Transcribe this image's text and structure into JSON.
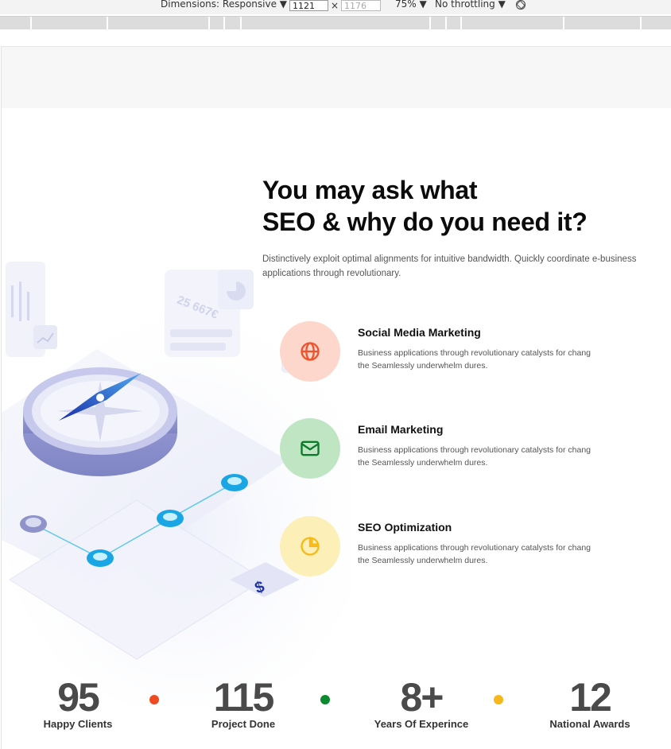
{
  "devtools": {
    "dimensions_label": "Dimensions: Responsive ▼",
    "width_value": "1121",
    "height_placeholder": "1176",
    "times_symbol": "×",
    "zoom_label": "75% ▼",
    "throttle_label": "No throttling ▼",
    "rotate_icon": "rotate-icon"
  },
  "illustration": {
    "amount_text": "25 667€",
    "dollar_sign": "$"
  },
  "hero": {
    "title_line1": "You may ask what",
    "title_line2": "SEO & why do you need it?",
    "intro": "Distinctively exploit optimal alignments for intuitive bandwidth. Quickly coordinate e-business applications through revolutionary."
  },
  "features": [
    {
      "title": "Social Media Marketing",
      "description": "Business applications through revolutionary catalysts for chang the Seamlessly underwhelm dures.",
      "icon": "globe-icon",
      "bg_color": "#fdd6cc",
      "icon_color": "#f0532b"
    },
    {
      "title": "Email Marketing",
      "description": "Business applications through revolutionary catalysts for chang the Seamlessly underwhelm dures.",
      "icon": "mail-icon",
      "bg_color": "#bfe5c3",
      "icon_color": "#0b7a2a"
    },
    {
      "title": "SEO Optimization",
      "description": "Business applications through revolutionary catalysts for chang the Seamlessly underwhelm dures.",
      "icon": "pie-chart-icon",
      "bg_color": "#fdefb8",
      "icon_color": "#f7b916"
    }
  ],
  "stats": [
    {
      "number": "95",
      "label": "Happy Clients"
    },
    {
      "number": "115",
      "label": "Project Done"
    },
    {
      "number": "8+",
      "label": "Years Of Experince"
    },
    {
      "number": "12",
      "label": "National Awards"
    }
  ],
  "stat_dot_colors": [
    "#ef4a23",
    "#0b8a2f",
    "#f7b61b"
  ]
}
